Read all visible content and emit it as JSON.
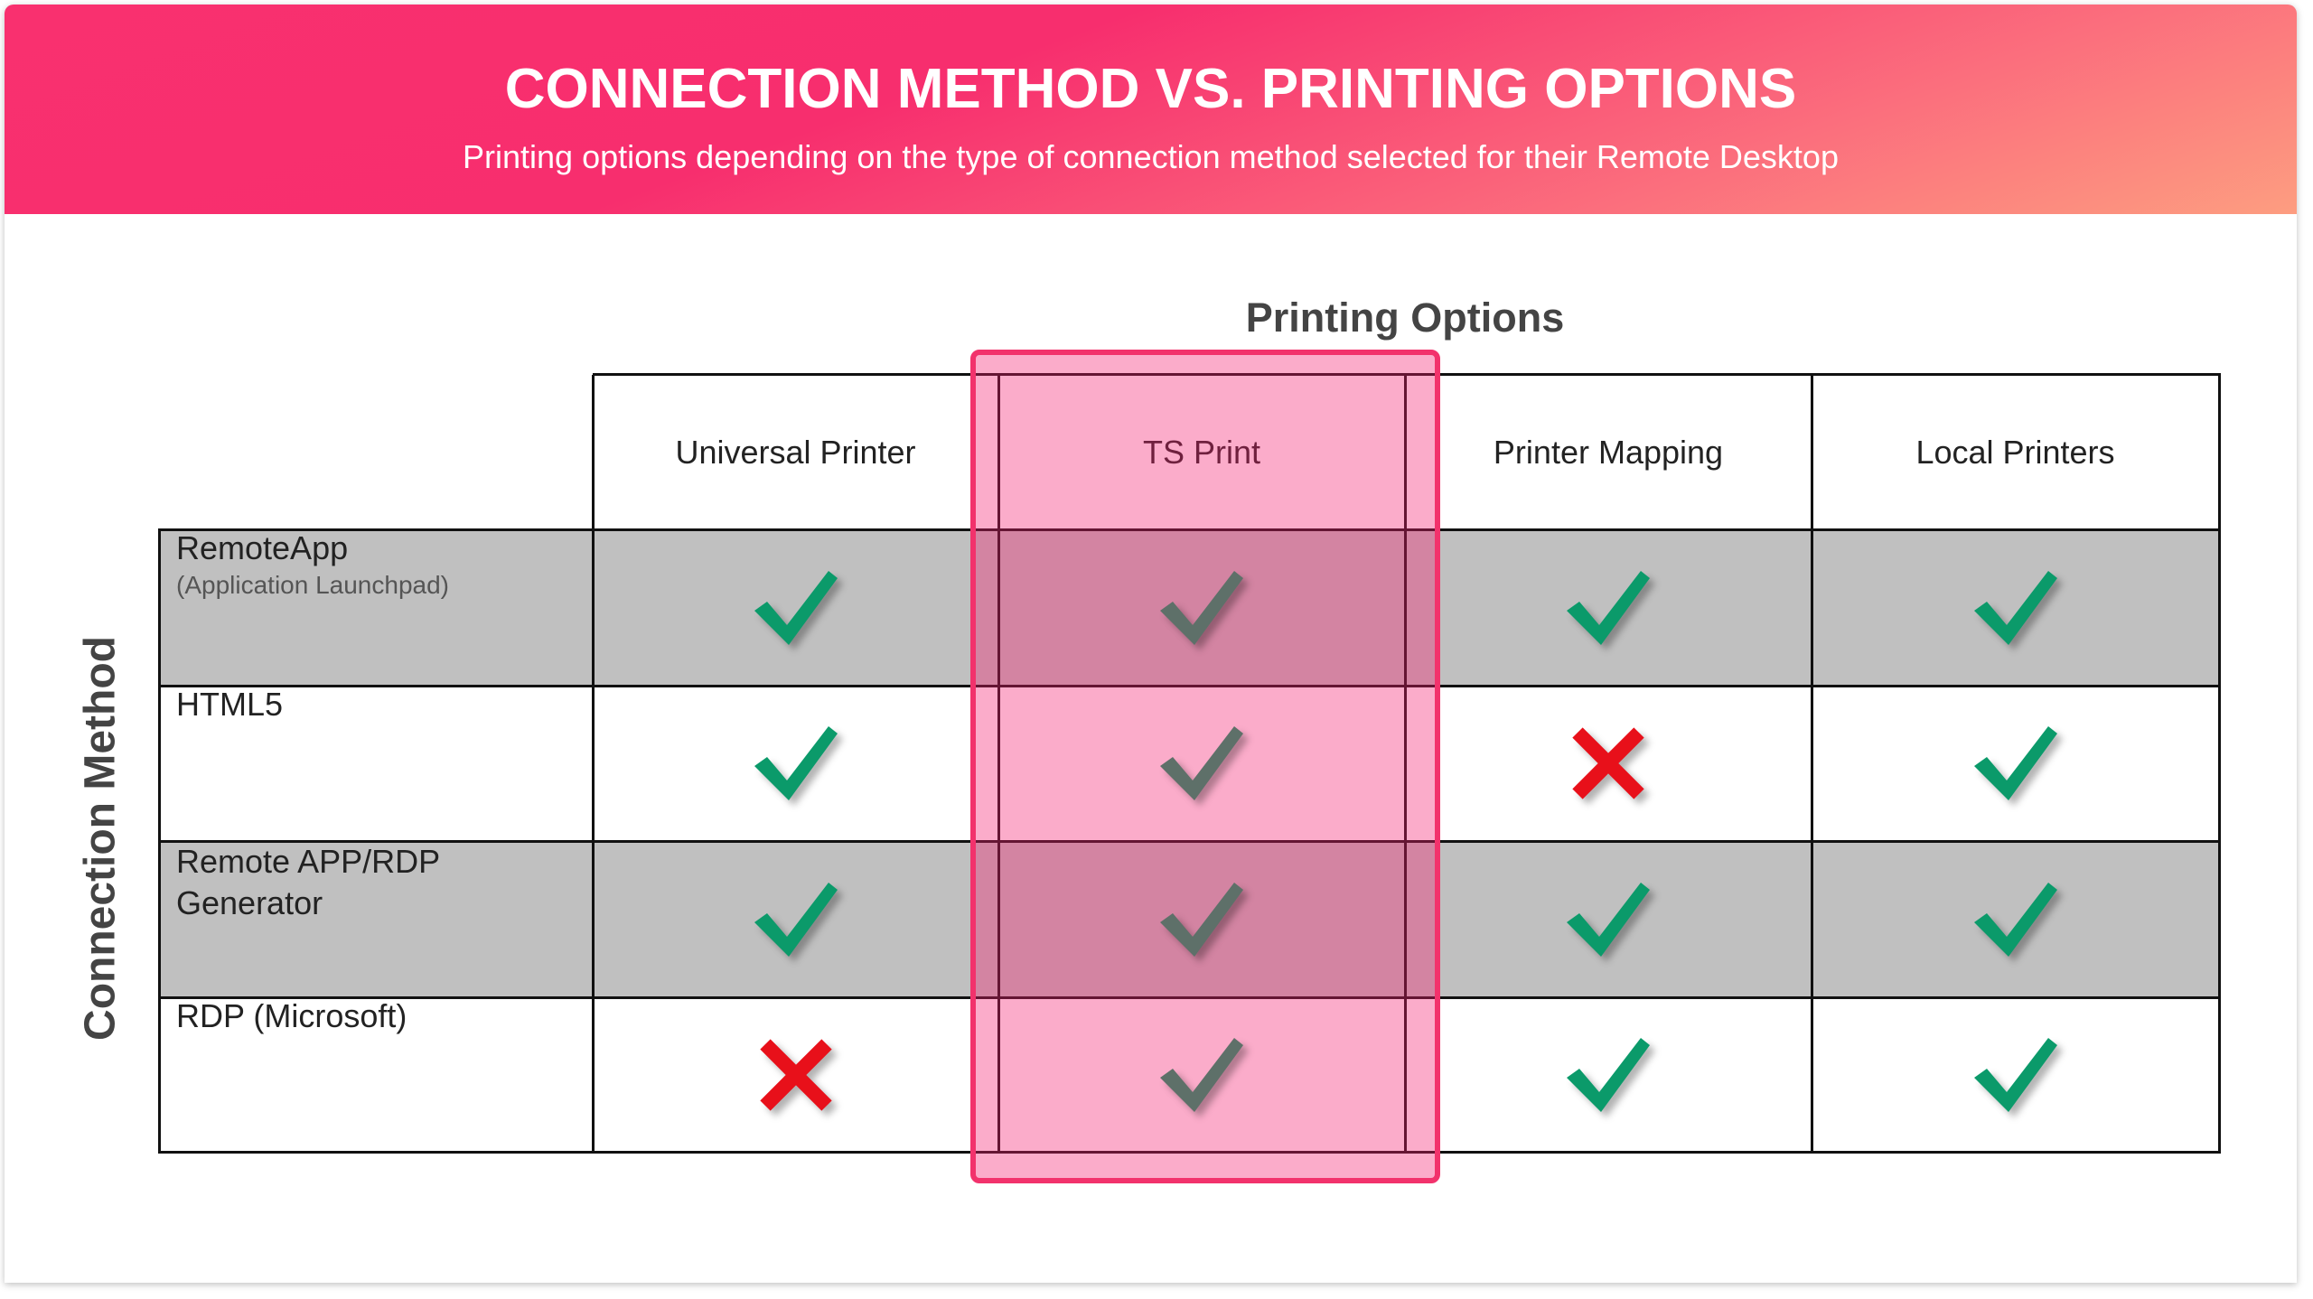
{
  "header": {
    "title": "CONNECTION METHOD VS. PRINTING OPTIONS",
    "subtitle": "Printing options depending on the type of connection method selected for their Remote Desktop"
  },
  "column_group_label": "Printing Options",
  "row_group_label": "Connection Method",
  "columns": [
    "Universal Printer",
    "TS Print",
    "Printer Mapping",
    "Local Printers"
  ],
  "highlighted_column": "TS Print",
  "rows": [
    {
      "label": "RemoteApp",
      "sublabel": "(Application Launchpad)",
      "values": [
        "check",
        "check",
        "check",
        "check"
      ]
    },
    {
      "label": "HTML5",
      "sublabel": "",
      "values": [
        "check",
        "check",
        "cross",
        "check"
      ]
    },
    {
      "label": "Remote APP/RDP Generator",
      "sublabel": "",
      "values": [
        "check",
        "check",
        "check",
        "check"
      ]
    },
    {
      "label": "RDP (Microsoft)",
      "sublabel": "",
      "values": [
        "cross",
        "check",
        "check",
        "check"
      ]
    }
  ],
  "colors": {
    "header_gradient_start": "#f72e6e",
    "header_gradient_end": "#fd9d80",
    "check": "#0b9a6a",
    "check_highlighted": "#5e7069",
    "cross": "#e8101a",
    "shaded_row": "#c0c0c0",
    "highlight_border": "#f2326c"
  }
}
